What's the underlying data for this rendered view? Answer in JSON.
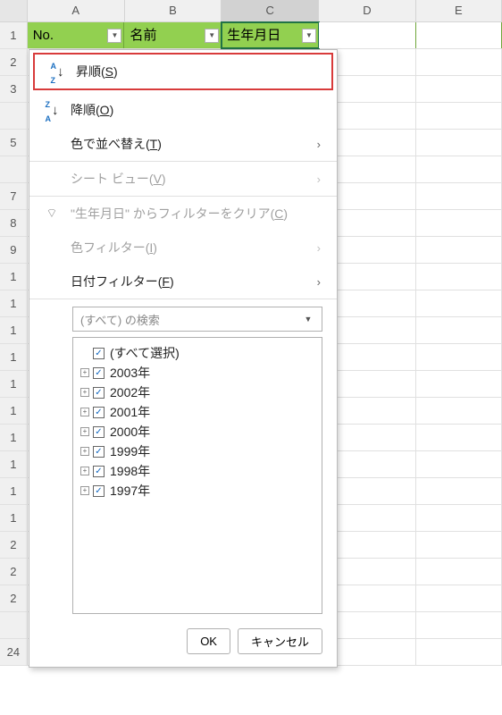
{
  "columns": [
    "A",
    "B",
    "C",
    "D",
    "E"
  ],
  "rows": [
    "1",
    "2",
    "3",
    "",
    "5",
    "",
    "7",
    "8",
    "9",
    "1",
    "1",
    "1",
    "1",
    "1",
    "1",
    "1",
    "1",
    "1",
    "1",
    "2",
    "2",
    "2",
    "",
    "24"
  ],
  "header_cells": {
    "a": "No.",
    "b": "名前",
    "c": "生年月日"
  },
  "menu": {
    "sort_asc": "昇順(",
    "sort_asc_key": "S",
    "sort_asc_end": ")",
    "sort_desc": "降順(",
    "sort_desc_key": "O",
    "sort_desc_end": ")",
    "sort_by_color": "色で並べ替え(",
    "sort_by_color_key": "T",
    "sort_by_color_end": ")",
    "sheet_view": "シート ビュー(",
    "sheet_view_key": "V",
    "sheet_view_end": ")",
    "clear_filter_pre": "\"",
    "clear_filter_col": "生年月日",
    "clear_filter_mid": "\" からフィルターをクリア(",
    "clear_filter_key": "C",
    "clear_filter_end": ")",
    "color_filter": "色フィルター(",
    "color_filter_key": "I",
    "color_filter_end": ")",
    "date_filter": "日付フィルター(",
    "date_filter_key": "F",
    "date_filter_end": ")"
  },
  "search_placeholder": "(すべて) の検索",
  "tree": {
    "select_all": "(すべて選択)",
    "items": [
      "2003年",
      "2002年",
      "2001年",
      "2000年",
      "1999年",
      "1998年",
      "1997年"
    ]
  },
  "buttons": {
    "ok": "OK",
    "cancel": "キャンセル"
  }
}
